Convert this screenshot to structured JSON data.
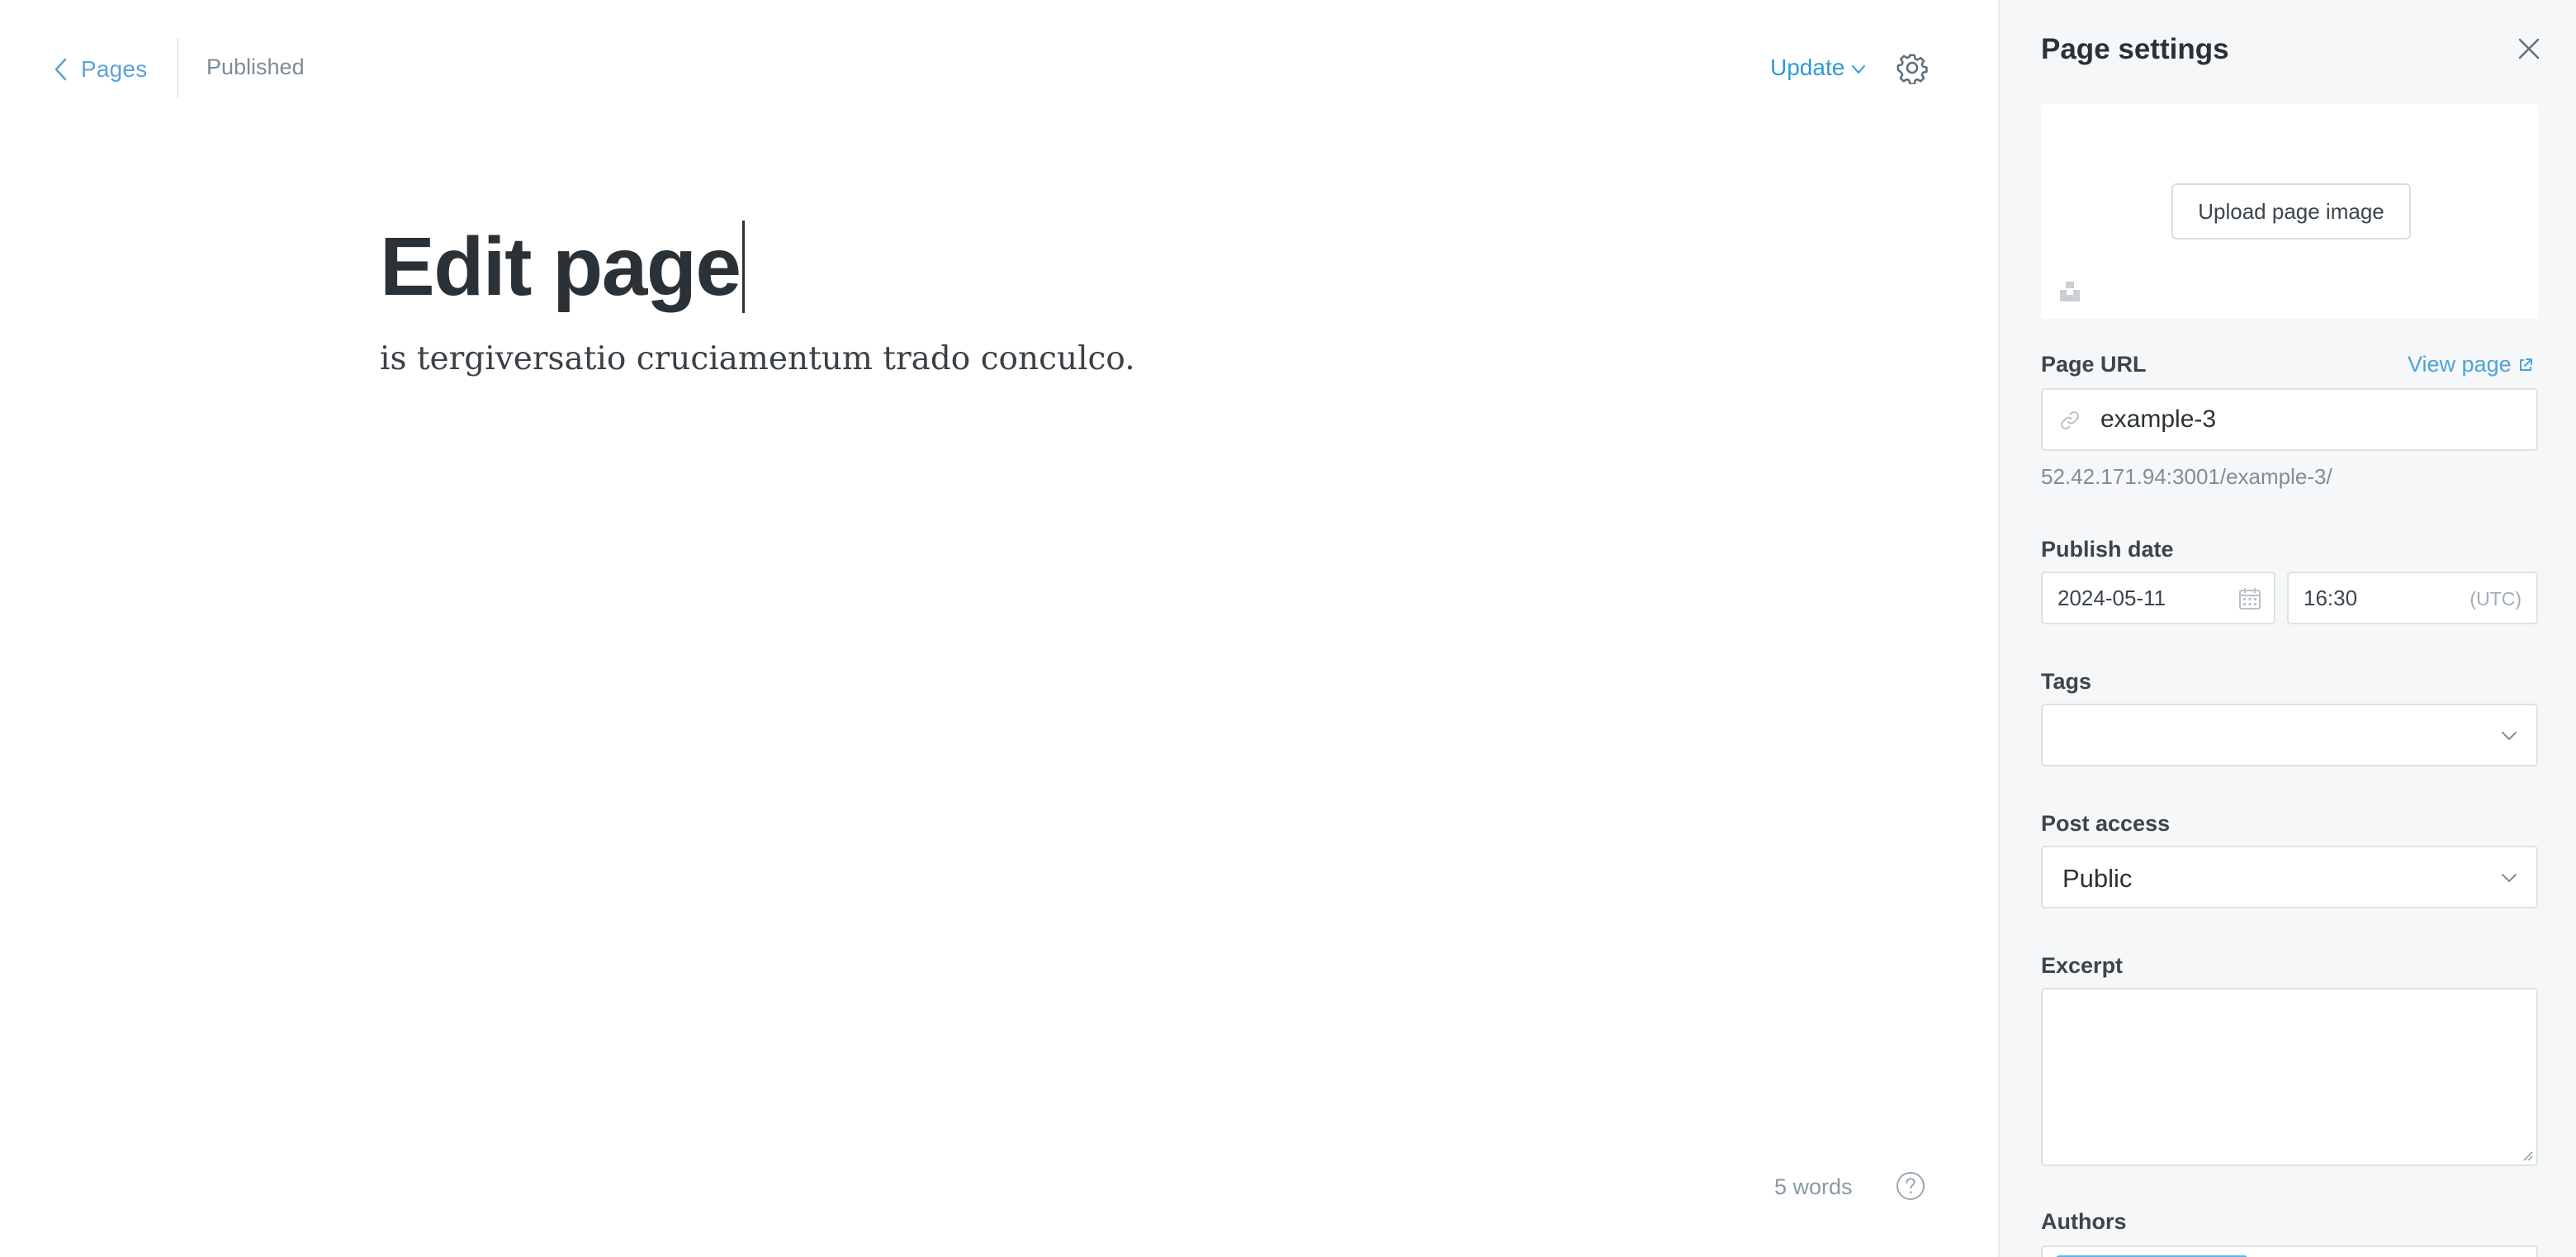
{
  "editor": {
    "back_label": "Pages",
    "status": "Published",
    "update_label": "Update",
    "title": "Edit page",
    "body": "is tergiversatio cruciamentum trado conculco.",
    "word_count": "5 words"
  },
  "settings": {
    "title": "Page settings",
    "upload_label": "Upload page image",
    "page_url_label": "Page URL",
    "view_page_label": "View page",
    "slug": "example-3",
    "url_hint": "52.42.171.94:3001/example-3/",
    "publish_date_label": "Publish date",
    "date": "2024-05-11",
    "time": "16:30",
    "timezone": "(UTC)",
    "tags_label": "Tags",
    "post_access_label": "Post access",
    "post_access_value": "Public",
    "excerpt_label": "Excerpt",
    "authors_label": "Authors"
  },
  "colors": {
    "accent": "#2e9ad6",
    "panel_bg": "#f6f7f8",
    "text_dark": "#2b3237"
  },
  "icons": [
    "chevron-left-icon",
    "chevron-down-icon",
    "gear-icon",
    "question-icon",
    "close-icon",
    "unsplash-icon",
    "external-link-icon",
    "link-icon",
    "calendar-icon"
  ]
}
